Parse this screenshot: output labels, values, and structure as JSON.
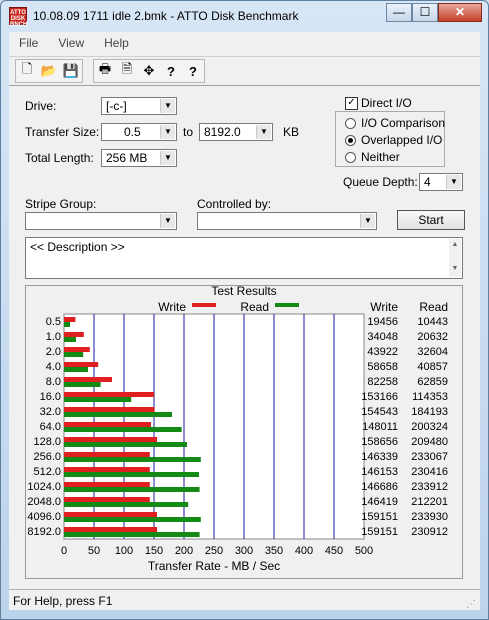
{
  "window": {
    "title": "10.08.09  1711 idle 2.bmk - ATTO Disk Benchmark",
    "app_icon_text": "ATTO\nDISK\nBENCH",
    "minimize": "—",
    "maximize": "☐",
    "close": "✕"
  },
  "menu": {
    "items": [
      "File",
      "View",
      "Help"
    ]
  },
  "toolbar": {
    "icons": [
      "new-file-icon",
      "open-folder-icon",
      "save-icon",
      "print-icon",
      "print-preview-icon",
      "move-icon",
      "help-icon",
      "context-help-icon"
    ],
    "glyphs": [
      "🗋",
      "📂",
      "💾",
      "🖶",
      "🗎",
      "✥",
      "?",
      "?"
    ]
  },
  "form": {
    "drive_label": "Drive:",
    "drive_value": "[-c-]",
    "transfer_size_label": "Transfer Size:",
    "transfer_from": "0.5",
    "to_label": "to",
    "transfer_to": "8192.0",
    "unit": "KB",
    "total_length_label": "Total Length:",
    "total_length_value": "256 MB",
    "direct_io_label": "Direct I/O",
    "direct_io_checked": true,
    "io_options": [
      "I/O Comparison",
      "Overlapped I/O",
      "Neither"
    ],
    "io_selected": "Overlapped I/O",
    "queue_depth_label": "Queue Depth:",
    "queue_depth_value": "4",
    "stripe_group_label": "Stripe Group:",
    "stripe_group_value": "",
    "controlled_by_label": "Controlled by:",
    "controlled_by_value": "",
    "start_label": "Start",
    "description": "<< Description >>"
  },
  "results": {
    "title": "Test Results",
    "legend_write": "Write",
    "legend_read": "Read",
    "col_write": "Write",
    "col_read": "Read",
    "write_color": "#e02020",
    "read_color": "#148a14",
    "xlabel": "Transfer Rate - MB / Sec"
  },
  "chart_data": {
    "type": "bar",
    "orientation": "horizontal",
    "title": "Test Results",
    "xlabel": "Transfer Rate - MB / Sec",
    "xlim": [
      0,
      500
    ],
    "xticks": [
      "0",
      "50",
      "100",
      "150",
      "200",
      "250",
      "300",
      "350",
      "400",
      "450",
      "500"
    ],
    "categories": [
      "0.5",
      "1.0",
      "2.0",
      "4.0",
      "8.0",
      "16.0",
      "32.0",
      "64.0",
      "128.0",
      "256.0",
      "512.0",
      "1024.0",
      "2048.0",
      "4096.0",
      "8192.0"
    ],
    "series": [
      {
        "name": "Write",
        "values": [
          19,
          33,
          43,
          57,
          80,
          150,
          151,
          145,
          155,
          143,
          143,
          143,
          143,
          155,
          155
        ],
        "table": [
          "19456",
          "34048",
          "43922",
          "58658",
          "82258",
          "153166",
          "154543",
          "148011",
          "158656",
          "146339",
          "146153",
          "146686",
          "146419",
          "159151",
          "159151"
        ]
      },
      {
        "name": "Read",
        "values": [
          10,
          20,
          32,
          40,
          61,
          112,
          180,
          196,
          205,
          228,
          225,
          226,
          207,
          228,
          226
        ],
        "table": [
          "10443",
          "20632",
          "32604",
          "40857",
          "62859",
          "114353",
          "184193",
          "200324",
          "209480",
          "233067",
          "230416",
          "233912",
          "212201",
          "233930",
          "230912"
        ]
      }
    ],
    "grid": true
  },
  "status": {
    "text": "For Help, press F1"
  }
}
